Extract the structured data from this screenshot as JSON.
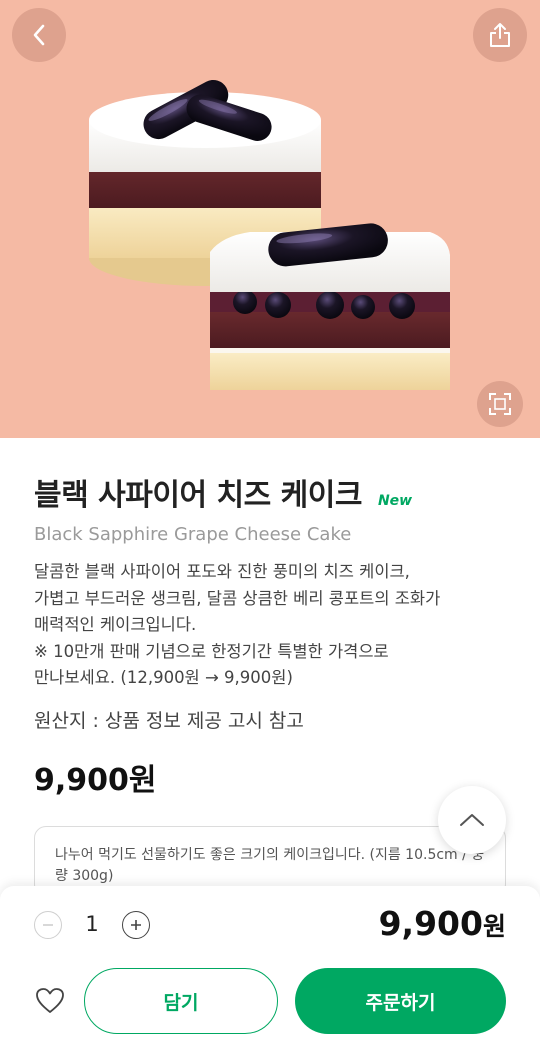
{
  "product": {
    "name_ko": "블랙 사파이어 치즈 케이크",
    "badge": "New",
    "name_en": "Black Sapphire Grape Cheese Cake",
    "description": [
      "달콤한 블랙 사파이어 포도와 진한 풍미의 치즈 케이크,",
      "가볍고 부드러운 생크림, 달콤 상큼한 베리 콩포트의 조화가",
      "매력적인 케이크입니다.",
      "※ 10만개 판매 기념으로 한정기간 특별한 가격으로",
      "만나보세요. (12,900원 → 9,900원)"
    ],
    "origin": "원산지 : 상품 정보 제공 고시 참고",
    "price": "9,900원",
    "note": "나누어 먹기도 선물하기도 좋은 크기의 케이크입니다. (지름 10.5cm / 중량 300g)"
  },
  "order": {
    "quantity": "1",
    "total_number": "9,900",
    "total_unit": "원",
    "cart_label": "담기",
    "order_label": "주문하기"
  },
  "icons": {
    "back": "chevron-left-icon",
    "share": "share-icon",
    "zoom": "expand-icon",
    "scroll_top": "chevron-up-icon",
    "minus": "minus-icon",
    "plus": "plus-icon",
    "wishlist": "heart-icon"
  },
  "colors": {
    "accent": "#00a862",
    "hero_bg": "#f5baa4"
  }
}
